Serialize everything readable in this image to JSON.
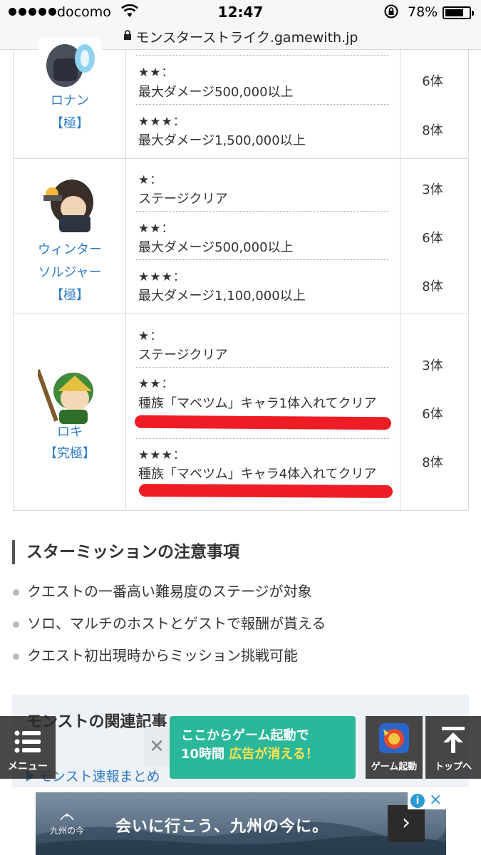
{
  "status_bar": {
    "carrier": "docomo",
    "time": "12:47",
    "battery_percent": "78%",
    "battery_level": 0.78
  },
  "url_bar": {
    "url": "モンスターストライク.gamewith.jp"
  },
  "missions": [
    {
      "name_lines": [
        "ロナン",
        "【極】"
      ],
      "conditions": [
        {
          "stars": "★★：",
          "text": "最大ダメージ500,000以上",
          "reward": "6体"
        },
        {
          "stars": "★★★：",
          "text": "最大ダメージ1,500,000以上",
          "reward": "8体"
        }
      ]
    },
    {
      "name_lines": [
        "ウィンター",
        "ソルジャー",
        "【極】"
      ],
      "conditions": [
        {
          "stars": "★：",
          "text": "ステージクリア",
          "reward": "3体"
        },
        {
          "stars": "★★：",
          "text": "最大ダメージ500,000以上",
          "reward": "6体"
        },
        {
          "stars": "★★★：",
          "text": "最大ダメージ1,100,000以上",
          "reward": "8体"
        }
      ]
    },
    {
      "name_lines": [
        "ロキ",
        "【究極】"
      ],
      "conditions": [
        {
          "stars": "★：",
          "text": "ステージクリア",
          "reward": "3体"
        },
        {
          "stars": "★★：",
          "text": "種族「マベツム」キャラ1体入れてクリア",
          "reward": "6体"
        },
        {
          "stars": "★★★：",
          "text": "種族「マベツム」キャラ4体入れてクリア",
          "reward": "8体"
        }
      ]
    }
  ],
  "notes": {
    "title": "スターミッションの注意事項",
    "items": [
      "クエストの一番高い難易度のステージが対象",
      "ソロ、マルチのホストとゲストで報酬が貰える",
      "クエスト初出現時からミッション挑戦可能"
    ]
  },
  "related": {
    "title": "モンストの関連記事",
    "link": "モンスト速報まとめ"
  },
  "bottom_bar": {
    "menu_label": "メニュー",
    "close_symbol": "✕",
    "promo_line1": "ここからゲーム起動で",
    "promo_line2_prefix": "10時間 ",
    "promo_line2_highlight": "広告が消える！",
    "launch_label": "ゲーム起動",
    "top_label": "トップへ"
  },
  "ad": {
    "logo_text": "九州の今",
    "headline": "会いに行こう、九州の今に。",
    "arrow": "›"
  },
  "colors": {
    "link_blue": "#2f7dc8",
    "highlight_red": "#ee1c24",
    "promo_green": "#2bb89a",
    "promo_highlight": "#ffe34d"
  },
  "icons": [
    "wifi-icon",
    "rotation-lock-icon",
    "lock-icon",
    "menu-icon",
    "close-icon",
    "game-launch-icon",
    "arrow-up-icon",
    "ad-info-icon"
  ]
}
